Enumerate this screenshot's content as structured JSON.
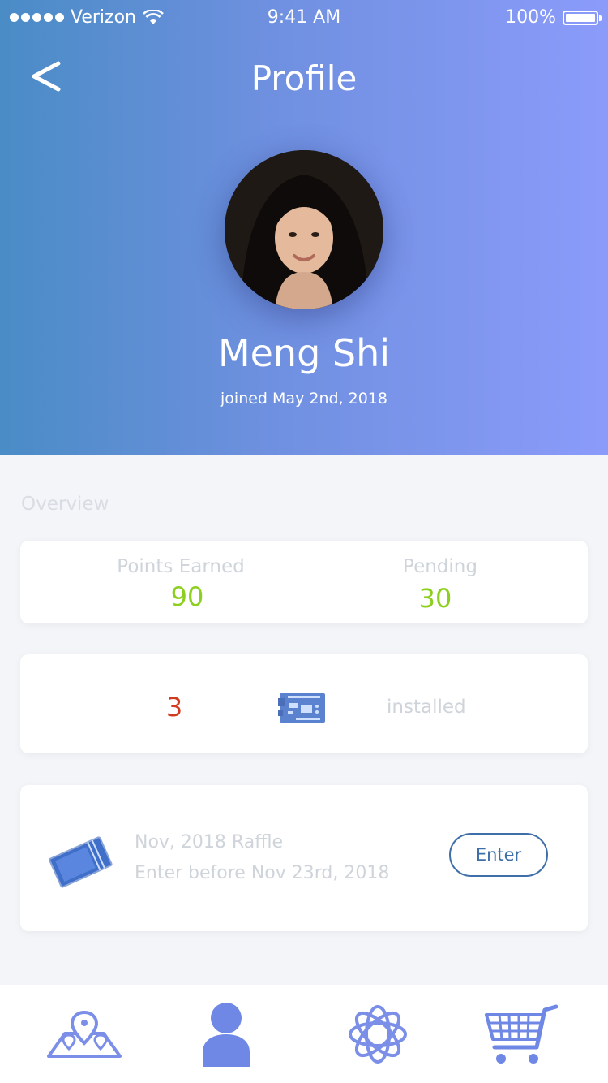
{
  "status_bar": {
    "carrier": "Verizon",
    "time": "9:41 AM",
    "battery": "100%"
  },
  "header": {
    "back_label": "<",
    "title": "Profile"
  },
  "profile": {
    "name": "Meng Shi",
    "joined": "joined May 2nd, 2018"
  },
  "overview": {
    "label": "Overview",
    "points_earned_label": "Points Earned",
    "points_earned_value": "90",
    "pending_label": "Pending",
    "pending_value": "30"
  },
  "devices": {
    "count": "3",
    "icon": "circuit-board-icon",
    "label": "installed"
  },
  "raffle": {
    "icon": "ticket-icon",
    "title": "Nov, 2018 Raffle",
    "subtitle": "Enter before Nov 23rd, 2018",
    "button_label": "Enter"
  },
  "tabbar": {
    "items": [
      {
        "icon": "map-icon"
      },
      {
        "icon": "profile-icon",
        "active": true
      },
      {
        "icon": "network-icon"
      },
      {
        "icon": "cart-icon"
      }
    ]
  },
  "colors": {
    "gradient_start": "#4a8cc6",
    "gradient_end": "#8b9bfa",
    "accent_green": "#8ccf1e",
    "accent_red": "#d23b1e",
    "icon_blue": "#6f88e6",
    "button_blue": "#3f6fa8"
  }
}
